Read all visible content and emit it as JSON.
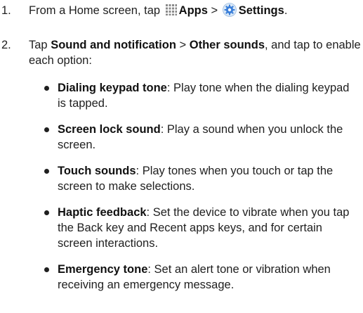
{
  "steps": [
    {
      "number": "1.",
      "prefix": "From a Home screen, tap ",
      "apps_label": "Apps",
      "separator": " > ",
      "settings_label": "Settings",
      "suffix": "."
    },
    {
      "number": "2.",
      "prefix": "Tap ",
      "path_a": "Sound and notification",
      "separator": " > ",
      "path_b": "Other sounds",
      "suffix": ", and tap to enable each option:"
    }
  ],
  "options": [
    {
      "title": "Dialing keypad tone",
      "description": ": Play tone when the dialing keypad is tapped."
    },
    {
      "title": "Screen lock sound",
      "description": ": Play a sound when you unlock the screen."
    },
    {
      "title": "Touch sounds",
      "description": ": Play tones when you touch or tap the screen to make selections."
    },
    {
      "title": "Haptic feedback",
      "description": ": Set the device to vibrate when you tap the Back key and Recent apps keys, and for certain screen interactions."
    },
    {
      "title": "Emergency tone",
      "description": ": Set an alert tone or vibration when receiving an emergency message."
    }
  ],
  "icons": {
    "apps": "apps-grid-icon",
    "settings": "settings-gear-icon"
  },
  "colors": {
    "text": "#1f1f1f",
    "apps_icon": "#8a8a8a",
    "settings_icon_blue": "#3b7fd9"
  }
}
